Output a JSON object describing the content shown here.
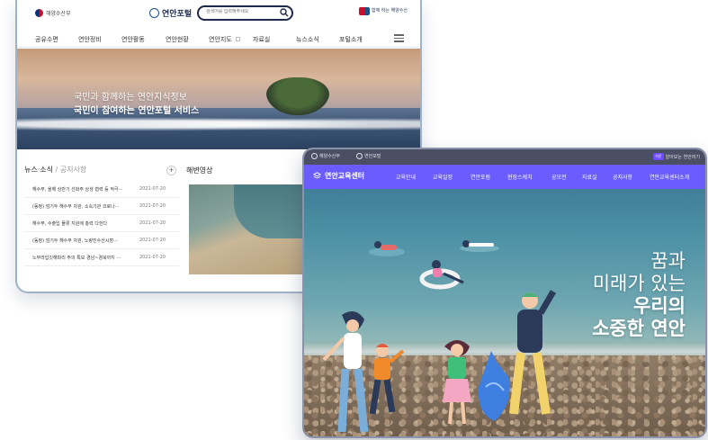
{
  "back_window": {
    "header": {
      "ministry": "해양수산부",
      "logo": "연안포털",
      "search_placeholder": "검색어를 입력해주세요",
      "partner": "함께 하는 해양수산"
    },
    "nav": [
      "공유수면",
      "연안정비",
      "연안활동",
      "연안현황",
      "연안지도",
      "자료실",
      "뉴스소식",
      "포털소개"
    ],
    "hero": {
      "line1": "국민과 함께하는 연안지식정보",
      "line2": "국민이 참여하는 연안포털 서비스"
    },
    "news": {
      "tab_active": "뉴스·소식",
      "tab_inactive": "공지사항",
      "plus": "+",
      "items": [
        {
          "title": "해수부, 올해 상반기 선화주 상생 협력 등 적극···",
          "date": "2021-07-20"
        },
        {
          "title": "(동정) 엄기두 해수부 차관, 소속기관 코로나···",
          "date": "2021-07-20"
        },
        {
          "title": "해수부, 수출입 물류 지원에 총력 다한다",
          "date": "2021-07-20"
        },
        {
          "title": "(동정) 엄기두 해수부 차관, 노량진수산시장···",
          "date": "2021-07-20"
        },
        {
          "title": "노무라입깃해파리 주의 특보 경남~경북까지 ···",
          "date": "2021-07-20"
        }
      ]
    },
    "video_title": "해변영상"
  },
  "front_window": {
    "topbar": {
      "ministry": "해양수산부",
      "portal": "연안포털",
      "easy": "알아보는 연안여기"
    },
    "brand": "연안교육센터",
    "nav": [
      "교육안내",
      "교육일정",
      "연안포럼",
      "현장스케치",
      "공모전",
      "자료실",
      "공지사항",
      "연안교육센터소개"
    ],
    "slogan": [
      "꿈과",
      "미래가 있는",
      "우리의",
      "소중한 연안"
    ]
  },
  "colors": {
    "front_nav": "#6a5cff",
    "front_topbar": "#4a4f63",
    "back_border": "#9fb3c8"
  }
}
